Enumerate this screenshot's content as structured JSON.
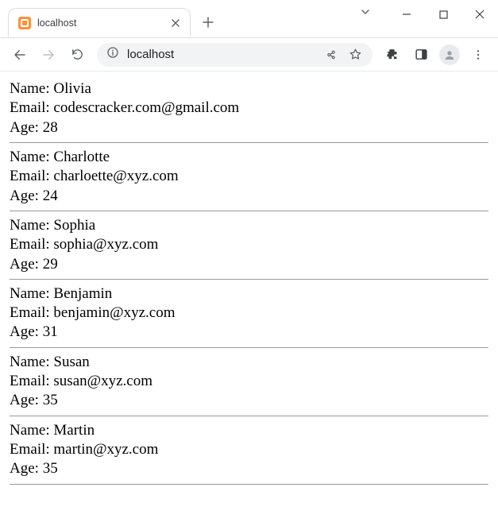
{
  "window": {
    "tab_title": "localhost",
    "url_text": "localhost"
  },
  "labels": {
    "name": "Name: ",
    "email": "Email: ",
    "age": "Age: "
  },
  "records": [
    {
      "name": "Olivia",
      "email": "codescracker.com@gmail.com",
      "age": "28"
    },
    {
      "name": "Charlotte",
      "email": "charloette@xyz.com",
      "age": "24"
    },
    {
      "name": "Sophia",
      "email": "sophia@xyz.com",
      "age": "29"
    },
    {
      "name": "Benjamin",
      "email": "benjamin@xyz.com",
      "age": "31"
    },
    {
      "name": "Susan",
      "email": "susan@xyz.com",
      "age": "35"
    },
    {
      "name": "Martin",
      "email": "martin@xyz.com",
      "age": "35"
    }
  ]
}
